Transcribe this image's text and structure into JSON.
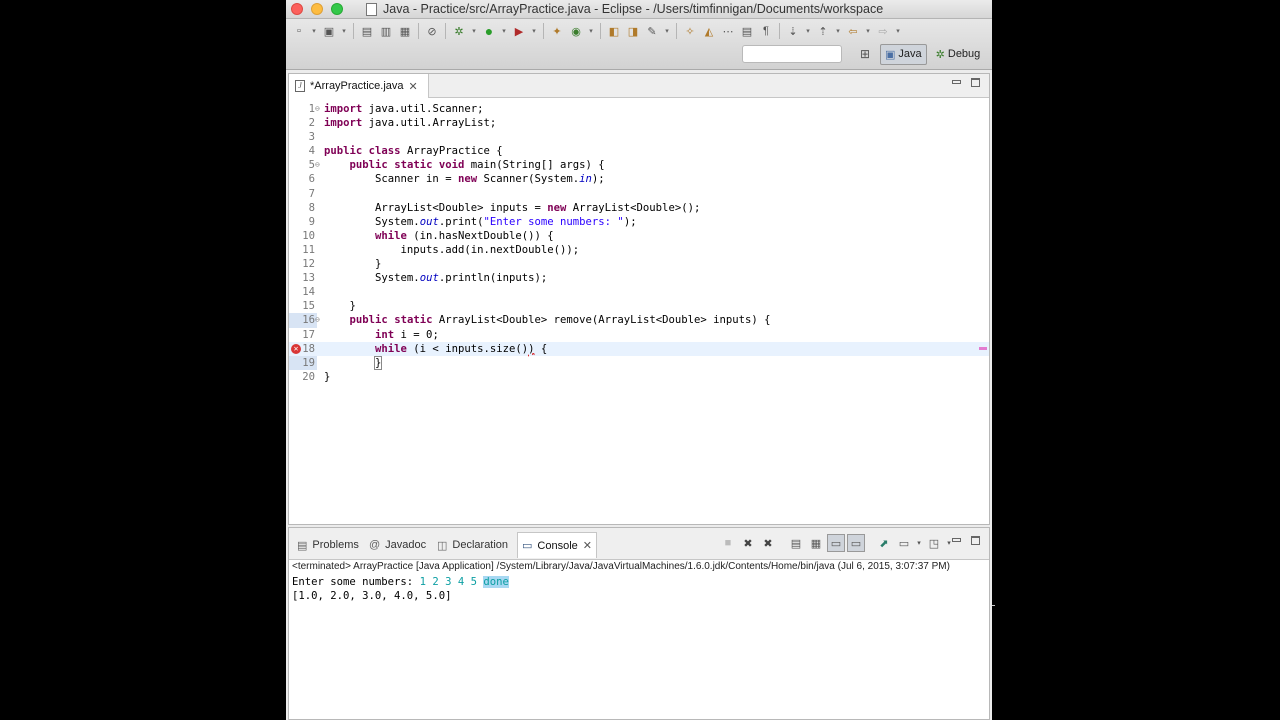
{
  "window": {
    "title": "Java - Practice/src/ArrayPractice.java - Eclipse - /Users/timfinnigan/Documents/workspace"
  },
  "perspectives": [
    {
      "label": "Java",
      "active": true
    },
    {
      "label": "Debug",
      "active": false
    }
  ],
  "editor": {
    "tab_label": "*ArrayPractice.java",
    "lines": [
      {
        "n": "1",
        "fold": true
      },
      {
        "n": "2"
      },
      {
        "n": "3"
      },
      {
        "n": "4"
      },
      {
        "n": "5",
        "fold": true
      },
      {
        "n": "6"
      },
      {
        "n": "7"
      },
      {
        "n": "8"
      },
      {
        "n": "9"
      },
      {
        "n": "10"
      },
      {
        "n": "11"
      },
      {
        "n": "12"
      },
      {
        "n": "13"
      },
      {
        "n": "14"
      },
      {
        "n": "15"
      },
      {
        "n": "16",
        "fold": true
      },
      {
        "n": "17"
      },
      {
        "n": "18",
        "error": true
      },
      {
        "n": "19"
      },
      {
        "n": "20"
      }
    ]
  },
  "code": {
    "l1_kw": "import",
    "l1_rest": " java.util.Scanner;",
    "l2_kw": "import",
    "l2_rest": " java.util.ArrayList;",
    "l4_kw1": "public",
    "l4_kw2": "class",
    "l4_rest": " ArrayPractice {",
    "l5_kw1": "public",
    "l5_kw2": "static",
    "l5_kw3": "void",
    "l5_rest": " main(String[] args) {",
    "l6_a": "Scanner in = ",
    "l6_kw": "new",
    "l6_b": " Scanner(System.",
    "l6_fld": "in",
    "l6_c": ");",
    "l8_a": "ArrayList<Double> inputs = ",
    "l8_kw": "new",
    "l8_b": " ArrayList<Double>();",
    "l9_a": "System.",
    "l9_fld": "out",
    "l9_b": ".print(",
    "l9_str": "\"Enter some numbers: \"",
    "l9_c": ");",
    "l10_kw": "while",
    "l10_rest": " (in.hasNextDouble()) {",
    "l11": "inputs.add(in.nextDouble());",
    "l12": "}",
    "l13_a": "System.",
    "l13_fld": "out",
    "l13_b": ".println(inputs);",
    "l15": "}",
    "l16_kw1": "public",
    "l16_kw2": "static",
    "l16_rest": " ArrayList<Double> remove(ArrayList<Double> inputs) {",
    "l17_kw": "int",
    "l17_rest": " i = 0;",
    "l18_kw": "while",
    "l18_a": " (i < inputs.size()",
    "l18_b": ")",
    "l18_c": " {",
    "l19": "}",
    "l20": "}"
  },
  "console": {
    "tabs": [
      {
        "label": "Problems",
        "icon": "problems-icon"
      },
      {
        "label": "Javadoc",
        "icon": "javadoc-icon"
      },
      {
        "label": "Declaration",
        "icon": "declaration-icon"
      },
      {
        "label": "Console",
        "icon": "console-icon",
        "active": true
      }
    ],
    "status": "<terminated> ArrayPractice [Java Application] /System/Library/Java/JavaVirtualMachines/1.6.0.jdk/Contents/Home/bin/java (Jul 6, 2015, 3:07:37 PM)",
    "prompt": "Enter some numbers: ",
    "user_input": "1 2 3 4 5 ",
    "user_input_selected": "done",
    "result": "[1.0, 2.0, 3.0, 4.0, 5.0]"
  },
  "colors": {
    "keyword": "#7f0055",
    "string": "#2a00ff",
    "field": "#0000c0",
    "console_input": "#0c9fa3",
    "error": "#d93636"
  }
}
